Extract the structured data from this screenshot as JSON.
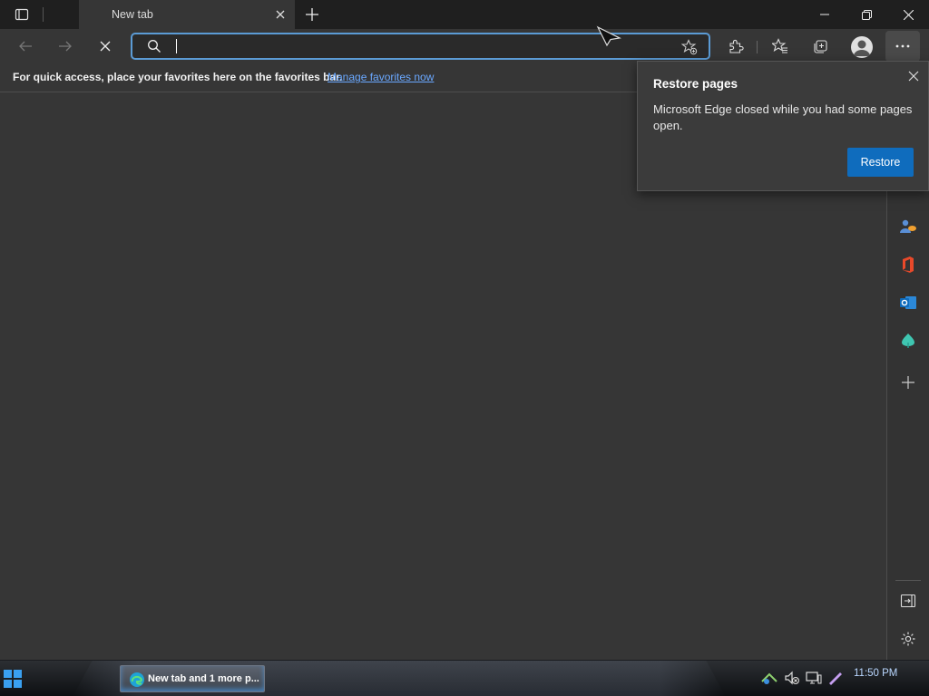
{
  "tab": {
    "title": "New tab"
  },
  "address": {
    "value": ""
  },
  "favorites_bar": {
    "message": "For quick access, place your favorites here on the favorites bar.",
    "link": "Manage favorites now"
  },
  "popup": {
    "title": "Restore pages",
    "body": "Microsoft Edge closed while you had some pages open.",
    "button": "Restore"
  },
  "taskbar": {
    "task_label": "New tab and 1 more p...",
    "clock": "11:50 PM"
  },
  "colors": {
    "accent": "#0f6cbd",
    "link": "#6aa8ff",
    "address_border": "#5b9bd5"
  }
}
